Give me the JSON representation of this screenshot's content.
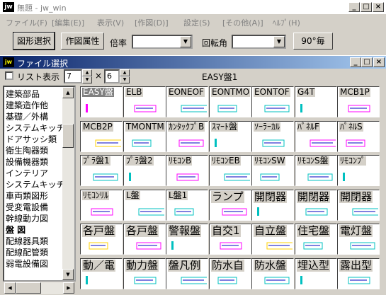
{
  "app": {
    "icon": "jw",
    "title": "無題 - jw_win"
  },
  "menu": [
    "ファイル(F)",
    "[編集(E)]",
    "表示(V)",
    "[作図(D)]",
    "設定(S)",
    "[その他(A)]",
    "ﾍﾙﾌﾟ(H)"
  ],
  "toolbar": {
    "select_label": "図形選択",
    "attr_label": "作図属性",
    "scale_label": "倍率",
    "rotation_label": "回転角",
    "deg90_label": "90°毎"
  },
  "file_select": {
    "title": "ファイル選択",
    "list_toggle_label": "リスト表示",
    "cols": "7",
    "rows": "6",
    "times": "×",
    "folder_label": "EASY盤1"
  },
  "categories": [
    "建築部品",
    "建築造作他",
    "基礎／外構",
    "システムキッチン",
    "ドアサッシ類",
    "衛生陶器類",
    "設備機器類",
    "インテリア",
    "システムキッチン類",
    "車両類図形",
    "受変電設備",
    "幹線動力図",
    "盤 図",
    "配線器具類",
    "配線配管類",
    "弱電設備図"
  ],
  "selected_category": "盤 図",
  "items": [
    {
      "label": "EASY盤",
      "c": "#ff00ff"
    },
    {
      "label": "ELB",
      "c": "#ff00ff"
    },
    {
      "label": "EONEOF",
      "c": "#00c0c0"
    },
    {
      "label": "EONTMO",
      "c": "#00c0c0"
    },
    {
      "label": "EONTOF",
      "c": "#00c0c0"
    },
    {
      "label": "G4T",
      "c": "#00c0c0"
    },
    {
      "label": "MCB1P",
      "c": "#ff00ff"
    },
    {
      "label": "MCB2P",
      "c": "#ffd000"
    },
    {
      "label": "TMONTM",
      "c": "#00c0c0"
    },
    {
      "label": "ｶﾝﾀｯｸﾌﾟB",
      "c": "#ff00ff"
    },
    {
      "label": "ｽﾏｰﾄ盤",
      "c": "#00c0c0"
    },
    {
      "label": "ｿｰﾗｰｶﾙ",
      "c": "#00c0c0"
    },
    {
      "label": "ﾊﾟﾈﾙF",
      "c": "#ff00ff"
    },
    {
      "label": "ﾊﾟﾈﾙS",
      "c": "#ff00ff"
    },
    {
      "label": "ﾌﾟﾗ盤1",
      "c": "#00c0c0"
    },
    {
      "label": "ﾌﾟﾗ盤2",
      "c": "#00c0c0"
    },
    {
      "label": "ﾘﾓｺﾝB",
      "c": "#ff00ff"
    },
    {
      "label": "ﾘﾓｺﾝEB",
      "c": "#00c0c0"
    },
    {
      "label": "ﾘﾓｺﾝSW",
      "c": "#00c0c0"
    },
    {
      "label": "ﾘﾓｺﾝS盤",
      "c": "#00c0c0"
    },
    {
      "label": "ﾘﾓｺﾝﾌﾟ",
      "c": "#00c0c0"
    },
    {
      "label": "ﾘﾓｺﾝﾘﾙ",
      "c": "#ff00ff"
    },
    {
      "label": "L盤",
      "c": "#00c0c0"
    },
    {
      "label": "L盤1",
      "c": "#00c0c0"
    },
    {
      "label": "ランプ",
      "c": "#ff00ff"
    },
    {
      "label": "開閉器",
      "c": "#00c0c0"
    },
    {
      "label": "開閉器",
      "c": "#00c0c0"
    },
    {
      "label": "開閉器",
      "c": "#00c0c0"
    },
    {
      "label": "各戸盤",
      "c": "#ffd000"
    },
    {
      "label": "各戸盤",
      "c": "#ff00ff"
    },
    {
      "label": "警報盤",
      "c": "#00c0c0"
    },
    {
      "label": "自交1",
      "c": "#ff00ff"
    },
    {
      "label": "自立盤",
      "c": "#ffd000"
    },
    {
      "label": "住宅盤",
      "c": "#00c0c0"
    },
    {
      "label": "電灯盤",
      "c": "#00c0c0"
    },
    {
      "label": "動／電",
      "c": "#00c0c0"
    },
    {
      "label": "動力盤",
      "c": "#00c0c0"
    },
    {
      "label": "盤凡例",
      "c": "#00c0c0"
    },
    {
      "label": "防水自",
      "c": "#00c0c0"
    },
    {
      "label": "防水盤",
      "c": "#00c0c0"
    },
    {
      "label": "埋込型",
      "c": "#00c0c0"
    },
    {
      "label": "露出型",
      "c": "#00c0c0"
    }
  ]
}
